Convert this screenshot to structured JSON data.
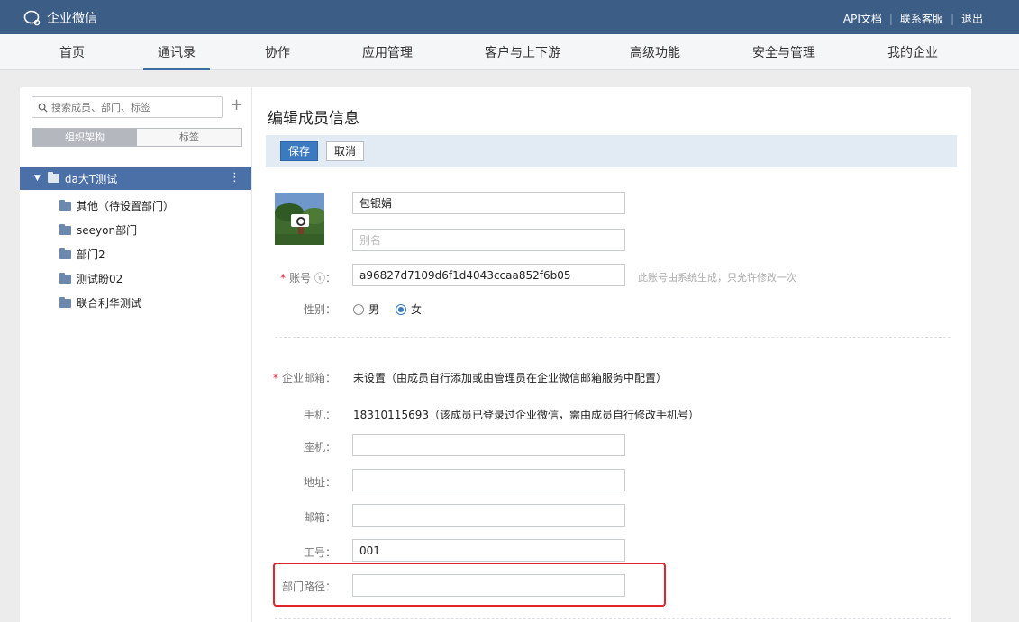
{
  "topbar": {
    "logo_text": "企业微信",
    "links": [
      "API文档",
      "联系客服",
      "退出"
    ]
  },
  "nav": {
    "items": [
      "首页",
      "通讯录",
      "协作",
      "应用管理",
      "客户与上下游",
      "高级功能",
      "安全与管理",
      "我的企业"
    ],
    "active": "通讯录"
  },
  "sidebar": {
    "search_placeholder": "搜索成员、部门、标签",
    "plus": "+",
    "seg_org": "组织架构",
    "seg_tag": "标签",
    "root": "da大T测试",
    "root_menu": "⋮",
    "items": [
      "其他（待设置部门）",
      "seeyon部门",
      "部门2",
      "测试盼02",
      "联合利华测试"
    ]
  },
  "form": {
    "title": "编辑成员信息",
    "save": "保存",
    "cancel": "取消",
    "name_value": "包银娟",
    "alias_placeholder": "别名",
    "account_label": "账号 ⓘ：",
    "account_value": "a96827d7109d6f1d4043ccaa852f6b05",
    "account_hint": "此账号由系统生成，只允许修改一次",
    "gender_label": "性别：",
    "gender_male": "男",
    "gender_female": "女",
    "gender_selected": "女",
    "email_label": "企业邮箱：",
    "email_value": "未设置（由成员自行添加或由管理员在企业微信邮箱服务中配置）",
    "phone_label": "手机：",
    "phone_value": "18310115693（该成员已登录过企业微信，需由成员自行修改手机号）",
    "tel_label": "座机：",
    "tel_value": "",
    "address_label": "地址：",
    "address_value": "",
    "mail_label": "邮箱：",
    "mail_value": "",
    "empno_label": "工号：",
    "empno_value": "001",
    "dept_path_label": "部门路径：",
    "dept_path_value": ""
  },
  "colors": {
    "topbar": "#3b5d86",
    "accent": "#3b79c0",
    "highlight": "#e0262b"
  }
}
